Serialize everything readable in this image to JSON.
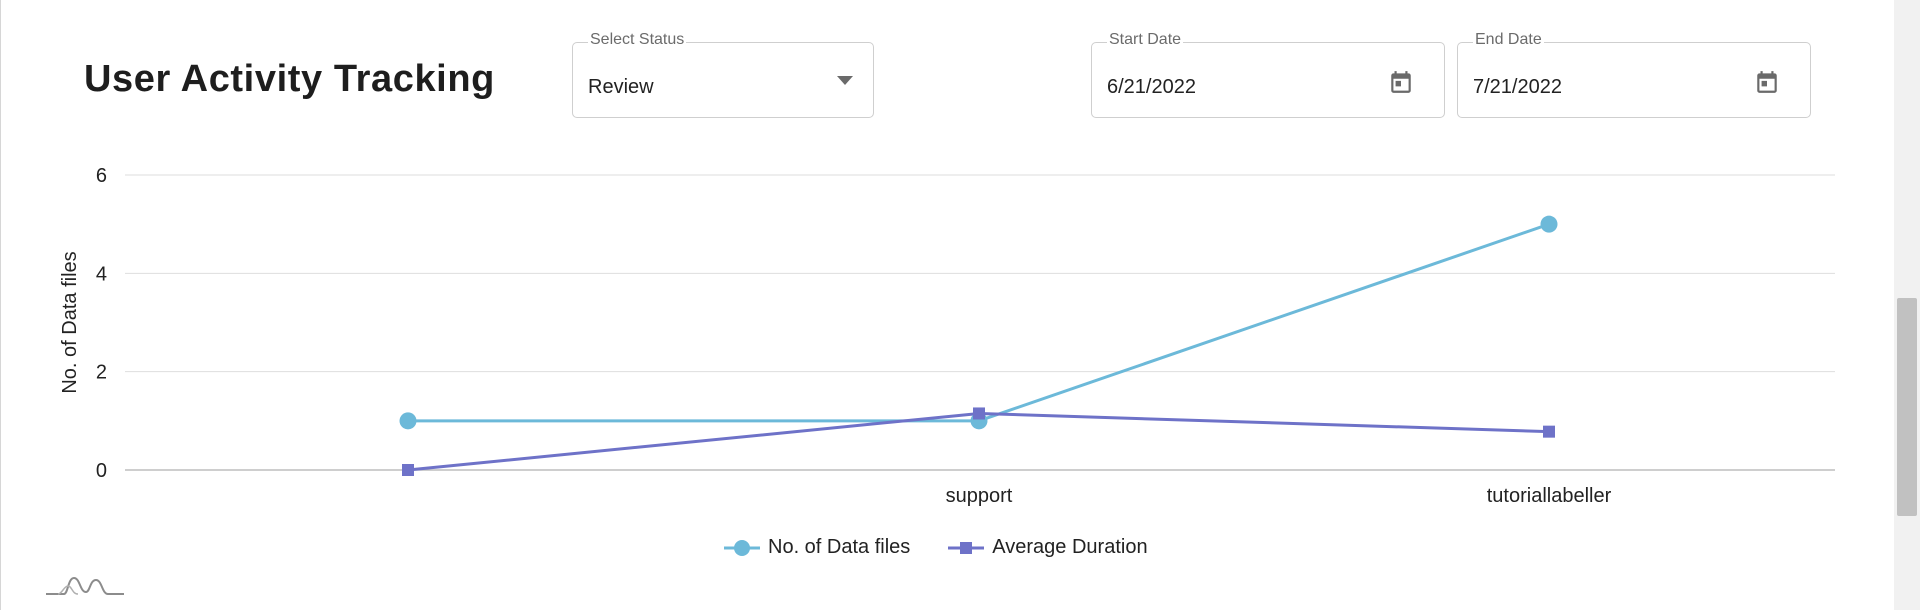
{
  "header": {
    "title": "User Activity Tracking"
  },
  "filters": {
    "status": {
      "label": "Select Status",
      "value": "Review"
    },
    "start_date": {
      "label": "Start Date",
      "value": "6/21/2022"
    },
    "end_date": {
      "label": "End Date",
      "value": "7/21/2022"
    }
  },
  "icons": {
    "status_dropdown": "chevron-down-icon",
    "start_date_picker": "calendar-icon",
    "end_date_picker": "calendar-icon",
    "logo": "mountain-logo-icon"
  },
  "colors": {
    "series_1": "#6cb9d9",
    "series_2": "#6e72c8",
    "grid": "#dedede",
    "axis": "#bdbdbd"
  },
  "chart_data": {
    "type": "line",
    "categories": [
      "",
      "support",
      "tutoriallabeller"
    ],
    "series": [
      {
        "name": "No. of Data files",
        "values": [
          1,
          1,
          5
        ],
        "marker": "circle"
      },
      {
        "name": "Average Duration",
        "values": [
          0,
          1.15,
          0.78
        ],
        "marker": "square"
      }
    ],
    "ylabel": "No. of Data files",
    "xlabel": "",
    "ylim": [
      0,
      6
    ],
    "yticks": [
      0,
      2,
      4,
      6
    ],
    "grid": true,
    "legend": "bottom-center"
  }
}
